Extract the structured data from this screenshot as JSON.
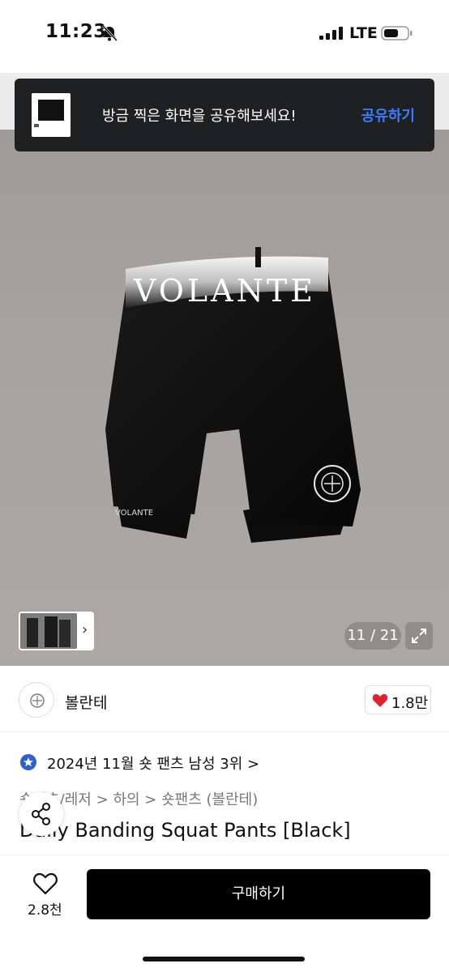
{
  "status_bar": {
    "time": "11:23",
    "network": "LTE"
  },
  "toast": {
    "message": "방금 찍은 화면을 공유해보세요!",
    "action": "공유하기"
  },
  "product_image": {
    "brand_text": "VOLANTE",
    "small_logo_text": "VOLANTE",
    "page_counter": "11 / 21"
  },
  "seller": {
    "name": "볼란테",
    "like_count": "1.8만"
  },
  "ranking": {
    "text": "2024년 11월 숏 팬츠 남성 3위",
    "chevron": ">"
  },
  "breadcrumb": {
    "items": [
      "숏팬츠/레저",
      "하의",
      "숏팬츠 (볼란테)"
    ],
    "separator": ">"
  },
  "product": {
    "title": "Daily Banding Squat Pants [Black]"
  },
  "bottom_bar": {
    "wish_count": "2.8천",
    "buy_label": "구매하기"
  },
  "colors": {
    "accent_blue": "#3c7bff",
    "heart_red": "#e0242f",
    "toast_bg": "#1f2022",
    "buy_bg": "#000000"
  },
  "icons": [
    "bell-slash-icon",
    "signal-icon",
    "battery-icon",
    "chevron-right-icon",
    "expand-icon",
    "heart-icon",
    "rank-badge-icon",
    "share-icon",
    "wish-heart-icon"
  ]
}
